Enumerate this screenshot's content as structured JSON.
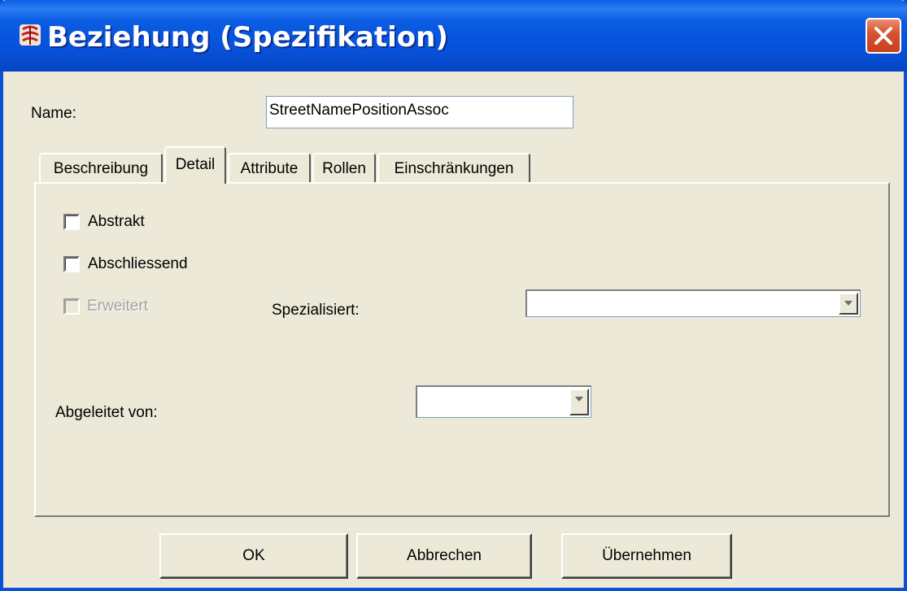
{
  "window": {
    "title": "Beziehung (Spezifikation)"
  },
  "form": {
    "name_label": "Name:",
    "name_value": "StreetNamePositionAssoc"
  },
  "tabs": [
    {
      "label": "Beschreibung",
      "active": false
    },
    {
      "label": "Detail",
      "active": true
    },
    {
      "label": "Attribute",
      "active": false
    },
    {
      "label": "Rollen",
      "active": false
    },
    {
      "label": "Einschränkungen",
      "active": false
    }
  ],
  "detail": {
    "abstrakt": {
      "label": "Abstrakt",
      "checked": false,
      "enabled": true
    },
    "abschliessend": {
      "label": "Abschliessend",
      "checked": false,
      "enabled": true
    },
    "erweitert": {
      "label": "Erweitert",
      "checked": false,
      "enabled": false
    },
    "spezialisiert_label": "Spezialisiert:",
    "spezialisiert_value": "",
    "abgeleitet_label": "Abgeleitet von:",
    "abgeleitet_value": ""
  },
  "buttons": {
    "ok": "OK",
    "cancel": "Abbrechen",
    "apply": "Übernehmen"
  },
  "icons": {
    "app": "app-icon",
    "close": "close-icon",
    "dropdown": "chevron-down-icon"
  }
}
